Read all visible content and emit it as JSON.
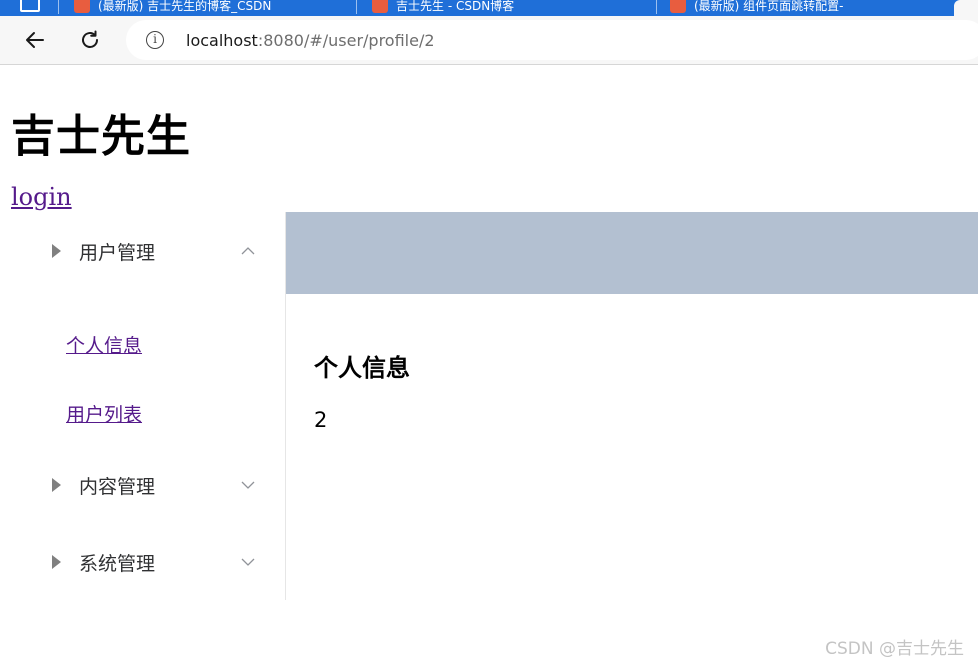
{
  "browser": {
    "tabs": [
      {
        "title": "(最新版) 吉士先生的博客_CSDN"
      },
      {
        "title": "吉士先生 - CSDN博客"
      },
      {
        "title": "(最新版) 组件页面跳转配置-"
      }
    ],
    "address": {
      "host": "localhost",
      "rest": ":8080/#/user/profile/2"
    }
  },
  "site": {
    "title": "吉士先生",
    "login_label": "login"
  },
  "sidebar": {
    "menus": [
      {
        "label": "用户管理",
        "expanded": true,
        "items": [
          "个人信息",
          "用户列表"
        ]
      },
      {
        "label": "内容管理",
        "expanded": false
      },
      {
        "label": "系统管理",
        "expanded": false
      }
    ]
  },
  "main": {
    "header_color": "#b3c0d1",
    "heading": "个人信息",
    "value": "2"
  },
  "watermark": "CSDN @吉士先生"
}
